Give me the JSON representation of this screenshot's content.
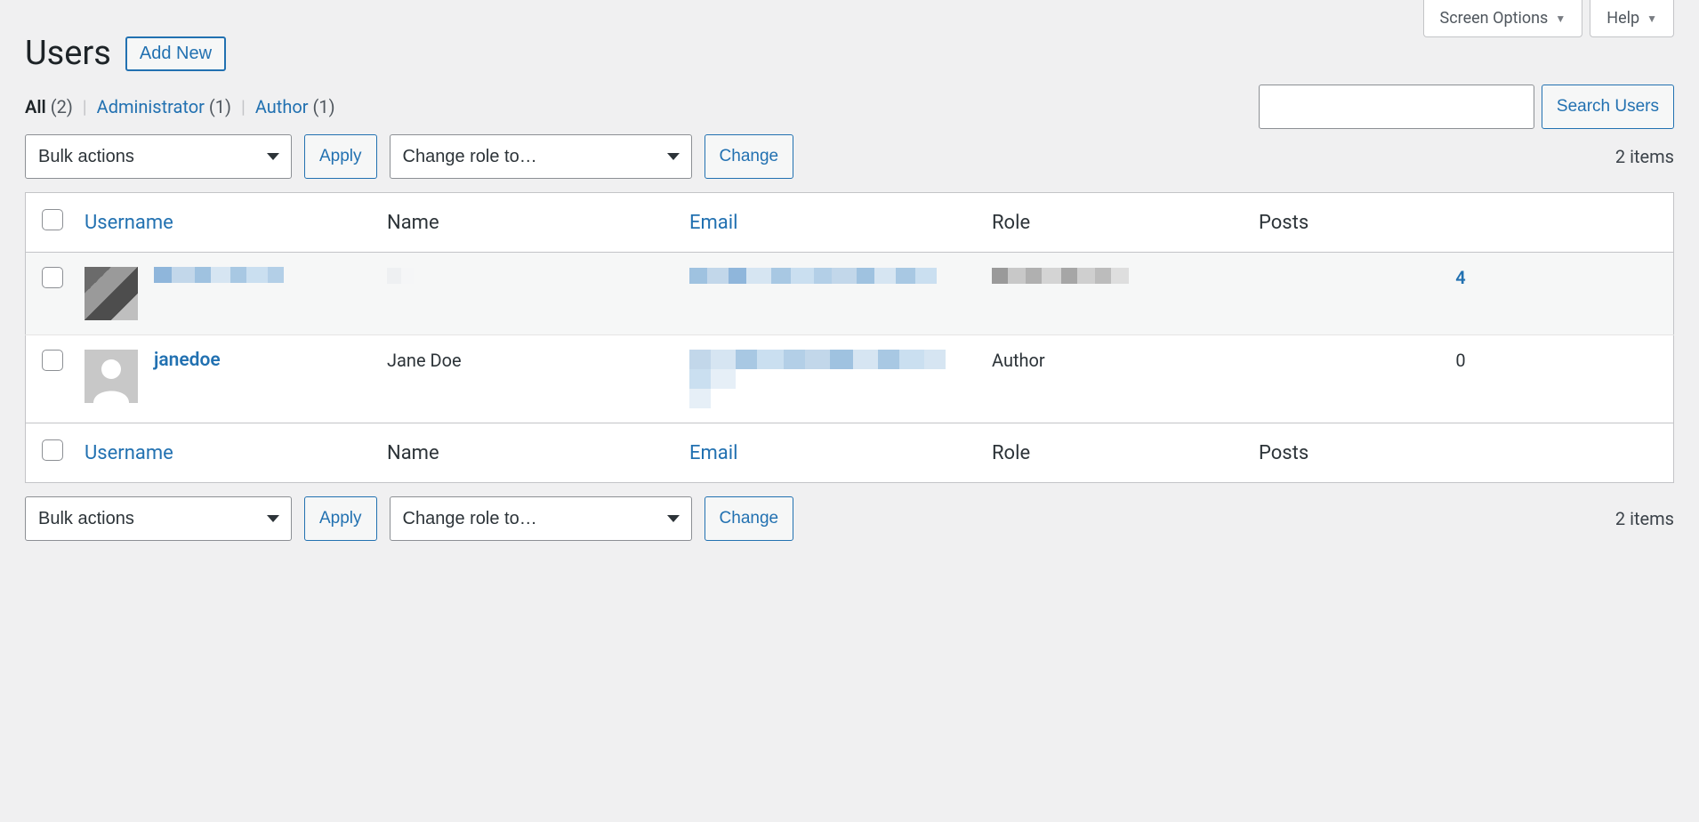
{
  "topTabs": {
    "screenOptions": "Screen Options",
    "help": "Help"
  },
  "page": {
    "title": "Users",
    "addNew": "Add New"
  },
  "filters": {
    "all_label": "All",
    "all_count": "(2)",
    "admin_label": "Administrator",
    "admin_count": "(1)",
    "author_label": "Author",
    "author_count": "(1)"
  },
  "search": {
    "button": "Search Users"
  },
  "bulk": {
    "bulkActions": "Bulk actions",
    "apply": "Apply",
    "changeRole": "Change role to…",
    "change": "Change"
  },
  "itemsCount": "2 items",
  "columns": {
    "username": "Username",
    "name": "Name",
    "email": "Email",
    "role": "Role",
    "posts": "Posts"
  },
  "rows": [
    {
      "username_redacted": true,
      "name_redacted": true,
      "email_redacted": true,
      "role_redacted": true,
      "posts": "4",
      "posts_link": true
    },
    {
      "username": "janedoe",
      "name": "Jane Doe",
      "email_redacted": true,
      "role": "Author",
      "posts": "0",
      "posts_link": false
    }
  ]
}
